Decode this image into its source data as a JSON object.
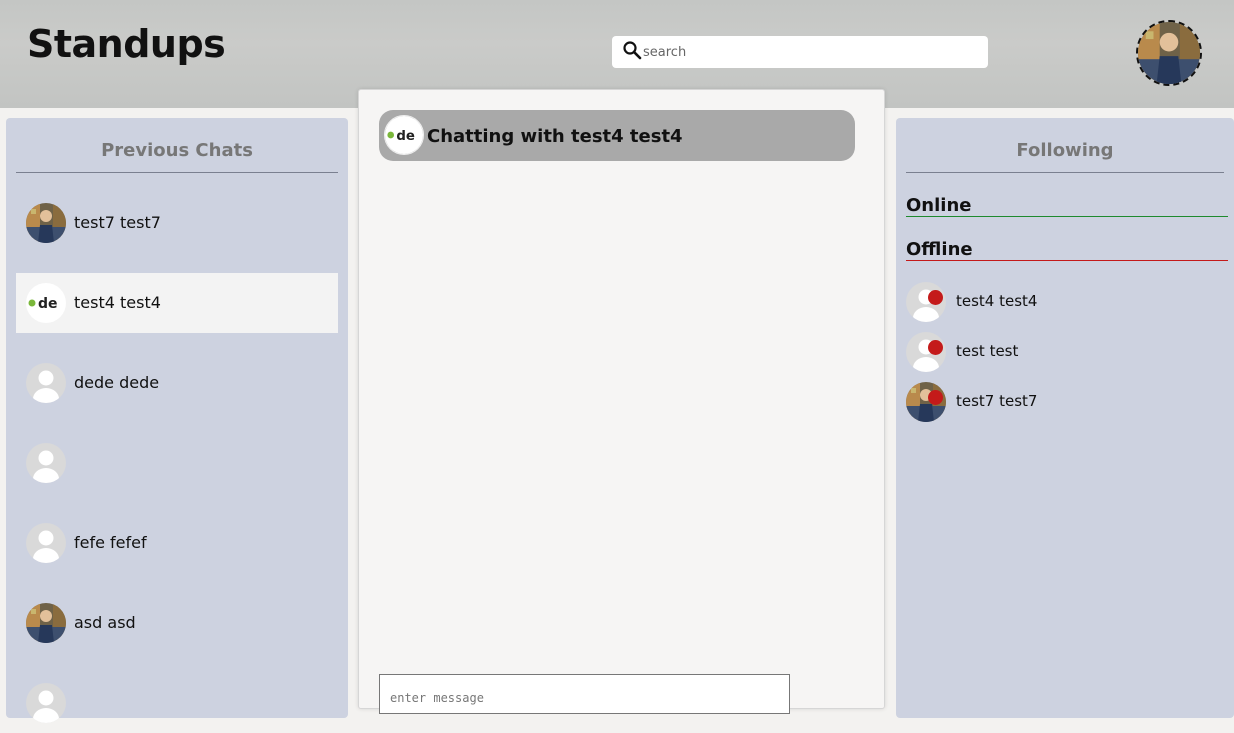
{
  "app": {
    "title": "Standups"
  },
  "search": {
    "placeholder": "search",
    "value": ""
  },
  "header": {
    "profile_avatar": "user-photo"
  },
  "previous_chats": {
    "title": "Previous Chats",
    "items": [
      {
        "name": "test7 test7",
        "avatar": "photo",
        "selected": false
      },
      {
        "name": "test4 test4",
        "avatar": "logo",
        "selected": true
      },
      {
        "name": "dede dede",
        "avatar": "default",
        "selected": false
      },
      {
        "name": "",
        "avatar": "default",
        "selected": false
      },
      {
        "name": "fefe fefef",
        "avatar": "default",
        "selected": false
      },
      {
        "name": "asd asd",
        "avatar": "photo",
        "selected": false
      }
    ]
  },
  "chat": {
    "title": "Chatting with test4 test4",
    "avatar": "logo",
    "input_placeholder": "enter message",
    "input_value": ""
  },
  "following": {
    "title": "Following",
    "online_label": "Online",
    "offline_label": "Offline",
    "online": [],
    "offline": [
      {
        "name": "test4 test4",
        "avatar": "default",
        "status": "offline"
      },
      {
        "name": "test test",
        "avatar": "default",
        "status": "offline"
      },
      {
        "name": "test7 test7",
        "avatar": "photo",
        "status": "offline"
      }
    ]
  },
  "colors": {
    "panel": "#cdd2e0",
    "online": "#1e8a2e",
    "offline": "#c41a1a",
    "chat_header": "#a9a9a9"
  }
}
